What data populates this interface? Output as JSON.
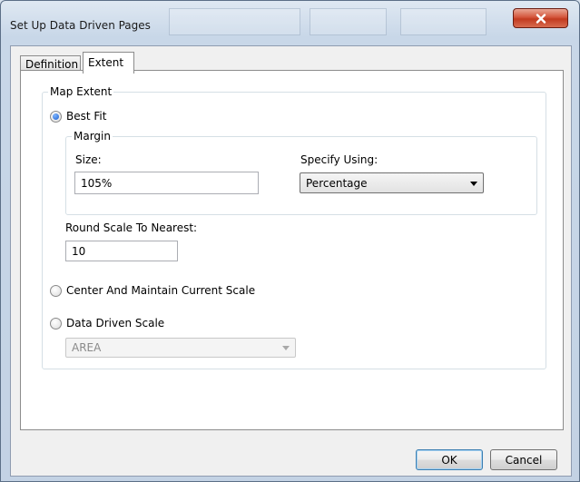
{
  "window": {
    "title": "Set Up Data Driven Pages"
  },
  "tabs": [
    {
      "label": "Definition",
      "active": false
    },
    {
      "label": "Extent",
      "active": true
    }
  ],
  "map_extent": {
    "legend": "Map Extent",
    "best_fit": {
      "label": "Best Fit",
      "selected": true,
      "margin": {
        "legend": "Margin",
        "size_label": "Size:",
        "size_value": "105%",
        "specify_using_label": "Specify Using:",
        "specify_using_value": "Percentage"
      },
      "round_scale_label": "Round Scale To Nearest:",
      "round_scale_value": "10"
    },
    "center_option": {
      "label": "Center And Maintain Current Scale",
      "selected": false
    },
    "data_driven_option": {
      "label": "Data Driven Scale",
      "selected": false,
      "field_value": "AREA",
      "field_enabled": false
    }
  },
  "buttons": {
    "ok": "OK",
    "cancel": "Cancel"
  },
  "colors": {
    "accent": "#1c5fcf",
    "close_button": "#c23b20",
    "panel_border": "#8c8c8c"
  }
}
